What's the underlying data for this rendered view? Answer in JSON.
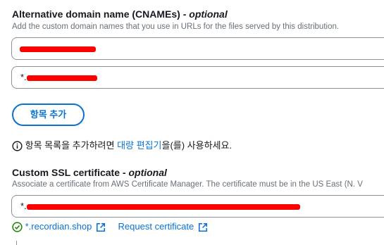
{
  "cnames": {
    "label": "Alternative domain name (CNAMEs)",
    "optional": "optional",
    "description": "Add the custom domain names that you use in URLs for the files served by this distribution.",
    "items": [
      {
        "value": ""
      },
      {
        "value": "*."
      }
    ],
    "add_button_label": "항목 추가",
    "info_prefix": "항목 목록을 추가하려면 ",
    "info_link": "대량 편집기",
    "info_suffix": "을(를) 사용하세요."
  },
  "ssl": {
    "label": "Custom SSL certificate",
    "optional": "optional",
    "description": "Associate a certificate from AWS Certificate Manager. The certificate must be in the US East (N. V",
    "value": "*.",
    "domain_link": "*.recordian.shop",
    "request_link": "Request certificate",
    "status_color": "#1d8102"
  },
  "icons": {
    "info": "info-icon",
    "success": "check-circle-icon",
    "external": "external-link-icon"
  }
}
